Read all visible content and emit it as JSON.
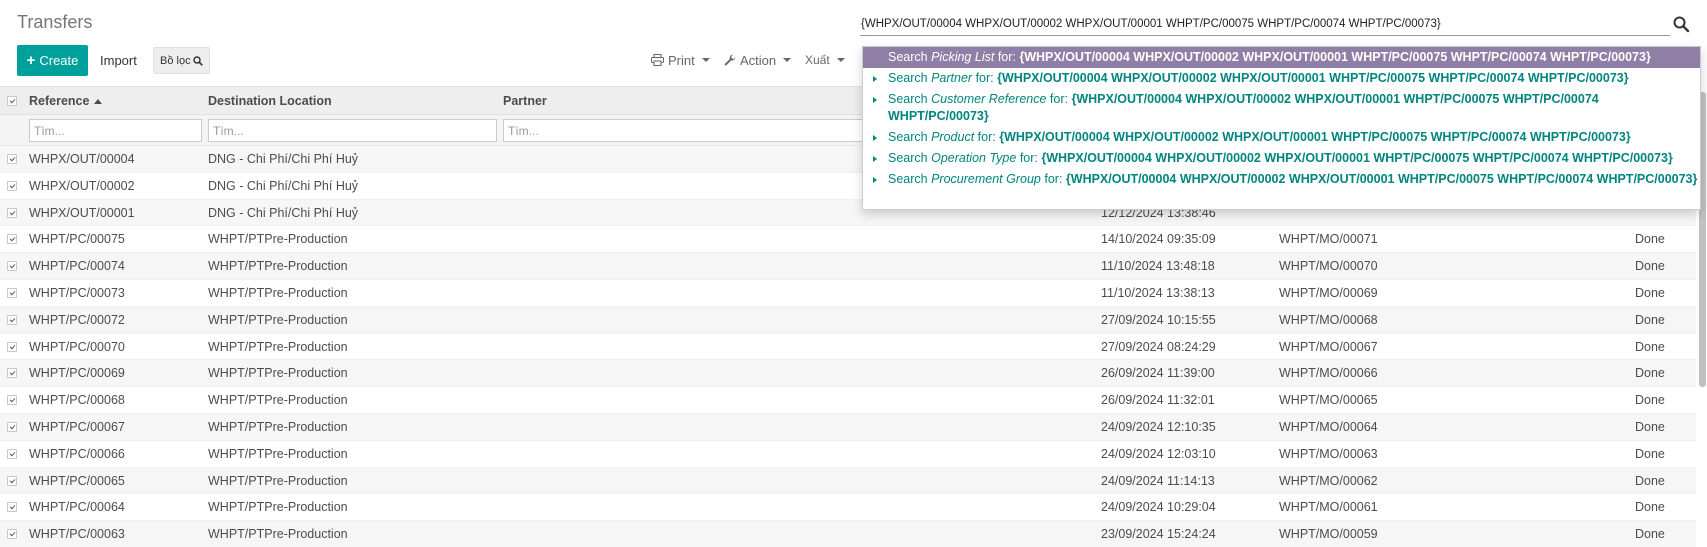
{
  "header": {
    "title": "Transfers",
    "create_label": "Create",
    "import_label": "Import",
    "filter_label": "Bồ lọc"
  },
  "toolbar": {
    "print_label": "Print",
    "action_label": "Action",
    "export_label": "Xuất"
  },
  "search": {
    "value": "{WHPX/OUT/00004 WHPX/OUT/00002 WHPX/OUT/00001 WHPT/PC/00075 WHPT/PC/00074 WHPT/PC/00073}"
  },
  "autocomplete": {
    "prefix": "Search",
    "suffix": "for:",
    "items": [
      {
        "field": "Picking List",
        "value": "{WHPX/OUT/00004 WHPX/OUT/00002 WHPX/OUT/00001 WHPT/PC/00075 WHPT/PC/00074 WHPT/PC/00073}"
      },
      {
        "field": "Partner",
        "value": "{WHPX/OUT/00004 WHPX/OUT/00002 WHPX/OUT/00001 WHPT/PC/00075 WHPT/PC/00074 WHPT/PC/00073}"
      },
      {
        "field": "Customer Reference",
        "value": "{WHPX/OUT/00004 WHPX/OUT/00002 WHPX/OUT/00001 WHPT/PC/00075 WHPT/PC/00074 WHPT/PC/00073}"
      },
      {
        "field": "Product",
        "value": "{WHPX/OUT/00004 WHPX/OUT/00002 WHPX/OUT/00001 WHPT/PC/00075 WHPT/PC/00074 WHPT/PC/00073}"
      },
      {
        "field": "Operation Type",
        "value": "{WHPX/OUT/00004 WHPX/OUT/00002 WHPX/OUT/00001 WHPT/PC/00075 WHPT/PC/00074 WHPT/PC/00073}"
      },
      {
        "field": "Procurement Group",
        "value": "{WHPX/OUT/00004 WHPX/OUT/00002 WHPX/OUT/00001 WHPT/PC/00075 WHPT/PC/00074 WHPT/PC/00073}"
      }
    ]
  },
  "table": {
    "columns": {
      "reference": "Reference",
      "destination": "Destination Location",
      "partner": "Partner"
    },
    "filter_placeholder": "Tìm...",
    "rows": [
      {
        "reference": "WHPX/OUT/00004",
        "destination": "DNG - Chi Phí/Chi Phí Huỷ",
        "date": "",
        "source": "",
        "status": ""
      },
      {
        "reference": "WHPX/OUT/00002",
        "destination": "DNG - Chi Phí/Chi Phí Huỷ",
        "date": "",
        "source": "",
        "status": ""
      },
      {
        "reference": "WHPX/OUT/00001",
        "destination": "DNG - Chi Phí/Chi Phí Huỷ",
        "date": "12/12/2024 13:38:46",
        "source": "",
        "status": ""
      },
      {
        "reference": "WHPT/PC/00075",
        "destination": "WHPT/PTPre-Production",
        "date": "14/10/2024 09:35:09",
        "source": "WHPT/MO/00071",
        "status": "Done"
      },
      {
        "reference": "WHPT/PC/00074",
        "destination": "WHPT/PTPre-Production",
        "date": "11/10/2024 13:48:18",
        "source": "WHPT/MO/00070",
        "status": "Done"
      },
      {
        "reference": "WHPT/PC/00073",
        "destination": "WHPT/PTPre-Production",
        "date": "11/10/2024 13:38:13",
        "source": "WHPT/MO/00069",
        "status": "Done"
      },
      {
        "reference": "WHPT/PC/00072",
        "destination": "WHPT/PTPre-Production",
        "date": "27/09/2024 10:15:55",
        "source": "WHPT/MO/00068",
        "status": "Done"
      },
      {
        "reference": "WHPT/PC/00070",
        "destination": "WHPT/PTPre-Production",
        "date": "27/09/2024 08:24:29",
        "source": "WHPT/MO/00067",
        "status": "Done"
      },
      {
        "reference": "WHPT/PC/00069",
        "destination": "WHPT/PTPre-Production",
        "date": "26/09/2024 11:39:00",
        "source": "WHPT/MO/00066",
        "status": "Done"
      },
      {
        "reference": "WHPT/PC/00068",
        "destination": "WHPT/PTPre-Production",
        "date": "26/09/2024 11:32:01",
        "source": "WHPT/MO/00065",
        "status": "Done"
      },
      {
        "reference": "WHPT/PC/00067",
        "destination": "WHPT/PTPre-Production",
        "date": "24/09/2024 12:10:35",
        "source": "WHPT/MO/00064",
        "status": "Done"
      },
      {
        "reference": "WHPT/PC/00066",
        "destination": "WHPT/PTPre-Production",
        "date": "24/09/2024 12:03:10",
        "source": "WHPT/MO/00063",
        "status": "Done"
      },
      {
        "reference": "WHPT/PC/00065",
        "destination": "WHPT/PTPre-Production",
        "date": "24/09/2024 11:14:13",
        "source": "WHPT/MO/00062",
        "status": "Done"
      },
      {
        "reference": "WHPT/PC/00064",
        "destination": "WHPT/PTPre-Production",
        "date": "24/09/2024 10:29:04",
        "source": "WHPT/MO/00061",
        "status": "Done"
      },
      {
        "reference": "WHPT/PC/00063",
        "destination": "WHPT/PTPre-Production",
        "date": "23/09/2024 15:24:24",
        "source": "WHPT/MO/00059",
        "status": "Done"
      }
    ]
  },
  "colors": {
    "primary": "#00A09D",
    "link": "#00857F",
    "highlight": "#8f7fa6"
  }
}
